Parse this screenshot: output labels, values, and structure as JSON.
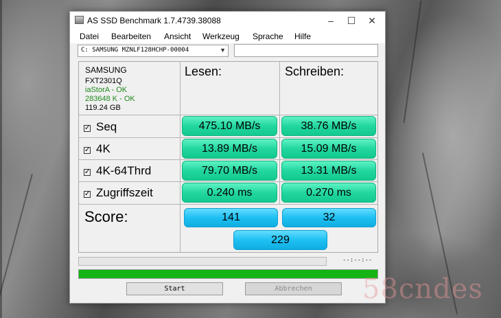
{
  "window": {
    "title": "AS SSD Benchmark 1.7.4739.38088"
  },
  "menu": [
    "Datei",
    "Bearbeiten",
    "Ansicht",
    "Werkzeug",
    "Sprache",
    "Hilfe"
  ],
  "drive": {
    "selected": "C: SAMSUNG MZNLF128HCHP-00004",
    "search_value": ""
  },
  "info": {
    "brand": "SAMSUNG",
    "firmware": "FXT2301Q",
    "driver": "iaStorA - OK",
    "alignment": "283648 K - OK",
    "size": "119.24 GB",
    "ok_color": "#1e8a1e"
  },
  "columns": {
    "read": "Lesen:",
    "write": "Schreiben:"
  },
  "rows": [
    {
      "label": "Seq",
      "checked": true,
      "read": "475.10 MB/s",
      "write": "38.76 MB/s"
    },
    {
      "label": "4K",
      "checked": true,
      "read": "13.89 MB/s",
      "write": "15.09 MB/s"
    },
    {
      "label": "4K-64Thrd",
      "checked": true,
      "read": "79.70 MB/s",
      "write": "13.31 MB/s"
    },
    {
      "label": "Zugriffszeit",
      "checked": true,
      "read": "0.240 ms",
      "write": "0.270 ms"
    }
  ],
  "score": {
    "label": "Score:",
    "read": "141",
    "write": "32",
    "total": "229"
  },
  "progress": {
    "timer": "--:--:--",
    "overall_fraction": 1.0
  },
  "buttons": {
    "start": "Start",
    "abort": "Abbrechen"
  },
  "watermark": "58cndes",
  "colors": {
    "result_bar": "#22d79f",
    "score_bar": "#1ec0f2",
    "progress_fill": "#14b414"
  }
}
